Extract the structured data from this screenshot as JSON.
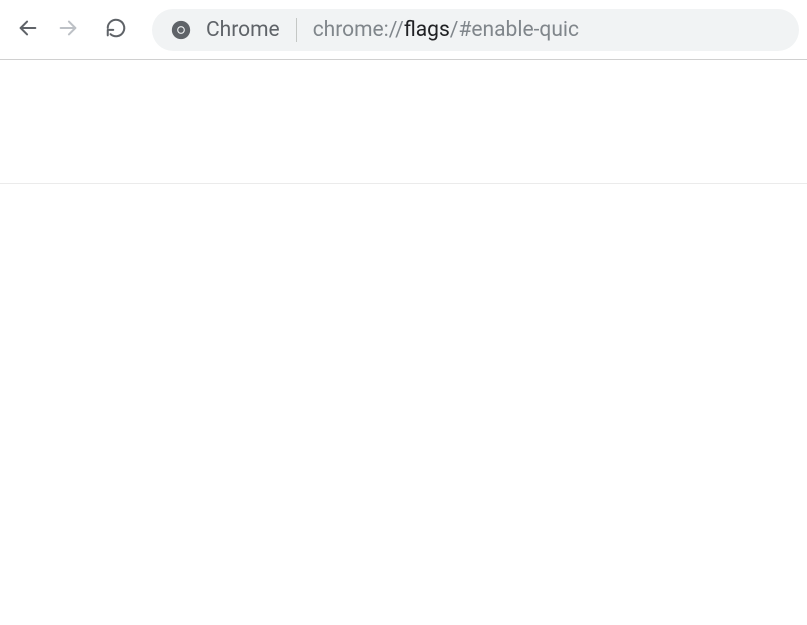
{
  "omnibox": {
    "site_label": "Chrome",
    "url_scheme": "chrome://",
    "url_host": "flags",
    "url_path": "/#enable-quic"
  }
}
